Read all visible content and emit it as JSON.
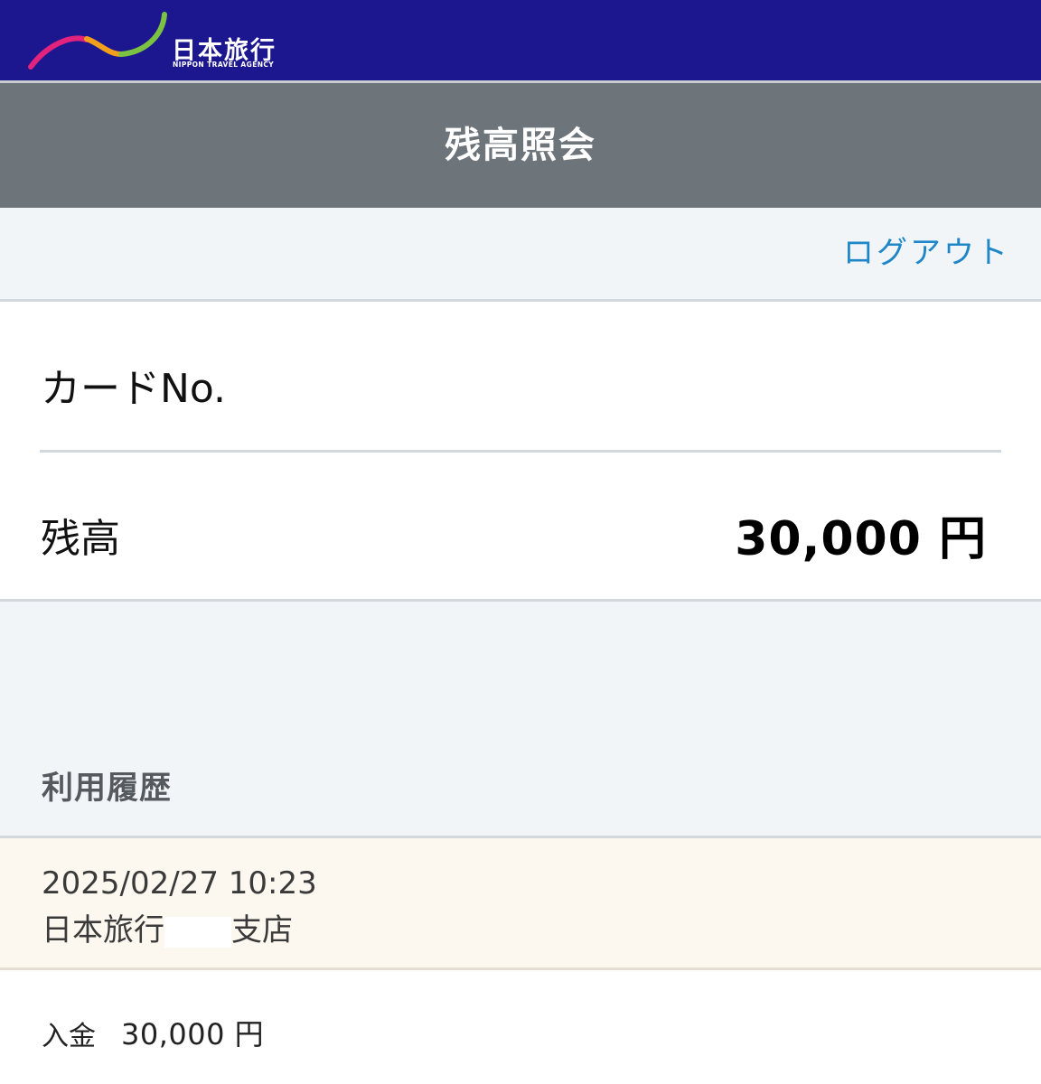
{
  "brand": {
    "name": "日本旅行",
    "tagline": "NIPPON TRAVEL AGENCY",
    "bar_color": "#1c178f",
    "logo_colors": [
      "#e2237e",
      "#f2a01c",
      "#7cc242"
    ]
  },
  "header": {
    "title": "残高照会"
  },
  "actions": {
    "logout_label": "ログアウト"
  },
  "card": {
    "card_no_label": "カードNo.",
    "card_no_value": "",
    "balance_label": "残高",
    "balance_value": "30,000 円"
  },
  "history": {
    "title": "利用履歴",
    "entries": [
      {
        "datetime": "2025/02/27 10:23",
        "store_prefix": "日本旅行",
        "store_suffix": "支店",
        "type": "入金",
        "amount": "30,000 円"
      }
    ]
  },
  "colors": {
    "title_bar": "#6d747a",
    "link": "#1f86c7",
    "panel_bg": "#f1f5f8",
    "entry_bg": "#fdf8ef"
  }
}
